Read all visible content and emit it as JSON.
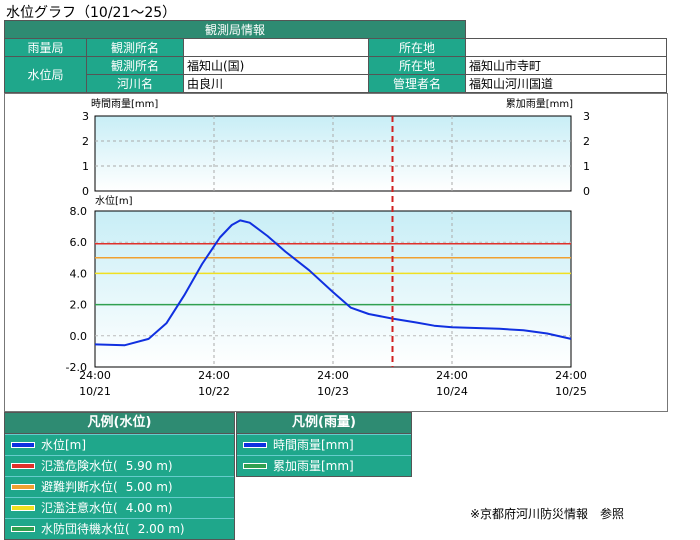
{
  "page_title": "水位グラフ（10/21～25）",
  "station": {
    "header": "観測局情報",
    "rain_station_label": "雨量局",
    "water_station_label": "水位局",
    "obs_name_label": "観測所名",
    "location_label": "所在地",
    "river_label": "河川名",
    "manager_label": "管理者名",
    "rain_obs_name": "",
    "rain_location": "",
    "water_obs_name": "福知山(国)",
    "water_location": "福知山市寺町",
    "river_name": "由良川",
    "manager_name": "福知山河川国道"
  },
  "chart_data": [
    {
      "type": "bar",
      "title": "",
      "ylabel_left": "時間雨量[mm]",
      "ylabel_right": "累加雨量[mm]",
      "ylim": [
        0,
        3
      ],
      "y_ticks": [
        "3",
        "2",
        "1",
        "0"
      ],
      "series": []
    },
    {
      "type": "line",
      "ylabel": "水位[m]",
      "ylim": [
        -2,
        8
      ],
      "y_ticks": [
        "8.0",
        "6.0",
        "4.0",
        "2.0",
        "0.0",
        "-2.0"
      ],
      "x_tick_labels": [
        [
          "24:00",
          "10/21"
        ],
        [
          "24:00",
          "10/22"
        ],
        [
          "24:00",
          "10/23"
        ],
        [
          "24:00",
          "10/24"
        ],
        [
          "24:00",
          "10/25"
        ]
      ],
      "x_range_days": [
        0,
        4
      ],
      "current_time_marker_day": 2.5,
      "thresholds": [
        {
          "name": "氾濫危険水位",
          "value": 5.9,
          "color": "#e0302a"
        },
        {
          "name": "避難判断水位",
          "value": 5.0,
          "color": "#f0a030"
        },
        {
          "name": "氾濫注意水位",
          "value": 4.0,
          "color": "#f0e020"
        },
        {
          "name": "水防団待機水位",
          "value": 2.0,
          "color": "#30a050"
        }
      ],
      "series": [
        {
          "name": "水位[m]",
          "color": "#1030e0",
          "points": [
            [
              0,
              -0.55
            ],
            [
              0.25,
              -0.6
            ],
            [
              0.45,
              -0.2
            ],
            [
              0.6,
              0.8
            ],
            [
              0.75,
              2.6
            ],
            [
              0.9,
              4.6
            ],
            [
              1.05,
              6.3
            ],
            [
              1.15,
              7.1
            ],
            [
              1.22,
              7.4
            ],
            [
              1.3,
              7.25
            ],
            [
              1.45,
              6.4
            ],
            [
              1.6,
              5.4
            ],
            [
              1.8,
              4.2
            ],
            [
              2.0,
              2.8
            ],
            [
              2.15,
              1.8
            ],
            [
              2.3,
              1.4
            ],
            [
              2.5,
              1.1
            ],
            [
              2.7,
              0.85
            ],
            [
              2.85,
              0.65
            ],
            [
              3.0,
              0.55
            ],
            [
              3.2,
              0.5
            ],
            [
              3.4,
              0.45
            ],
            [
              3.6,
              0.35
            ],
            [
              3.8,
              0.15
            ],
            [
              4.0,
              -0.2
            ]
          ]
        }
      ]
    }
  ],
  "legend_water": {
    "title": "凡例(水位)",
    "items": [
      {
        "label": "水位[m]",
        "value": "",
        "color": "#1030e0"
      },
      {
        "label": "氾濫危険水位(",
        "value": "5.90 m)",
        "color": "#e0302a"
      },
      {
        "label": "避難判断水位(",
        "value": "5.00 m)",
        "color": "#f0a030"
      },
      {
        "label": "氾濫注意水位(",
        "value": "4.00 m)",
        "color": "#f0e020"
      },
      {
        "label": "水防団待機水位(",
        "value": "2.00 m)",
        "color": "#30a050"
      }
    ]
  },
  "legend_rain": {
    "title": "凡例(雨量)",
    "items": [
      {
        "label": "時間雨量[mm]",
        "color": "#1030e0"
      },
      {
        "label": "累加雨量[mm]",
        "color": "#30a050"
      }
    ]
  },
  "footer": "※京都府河川防災情報　参照"
}
